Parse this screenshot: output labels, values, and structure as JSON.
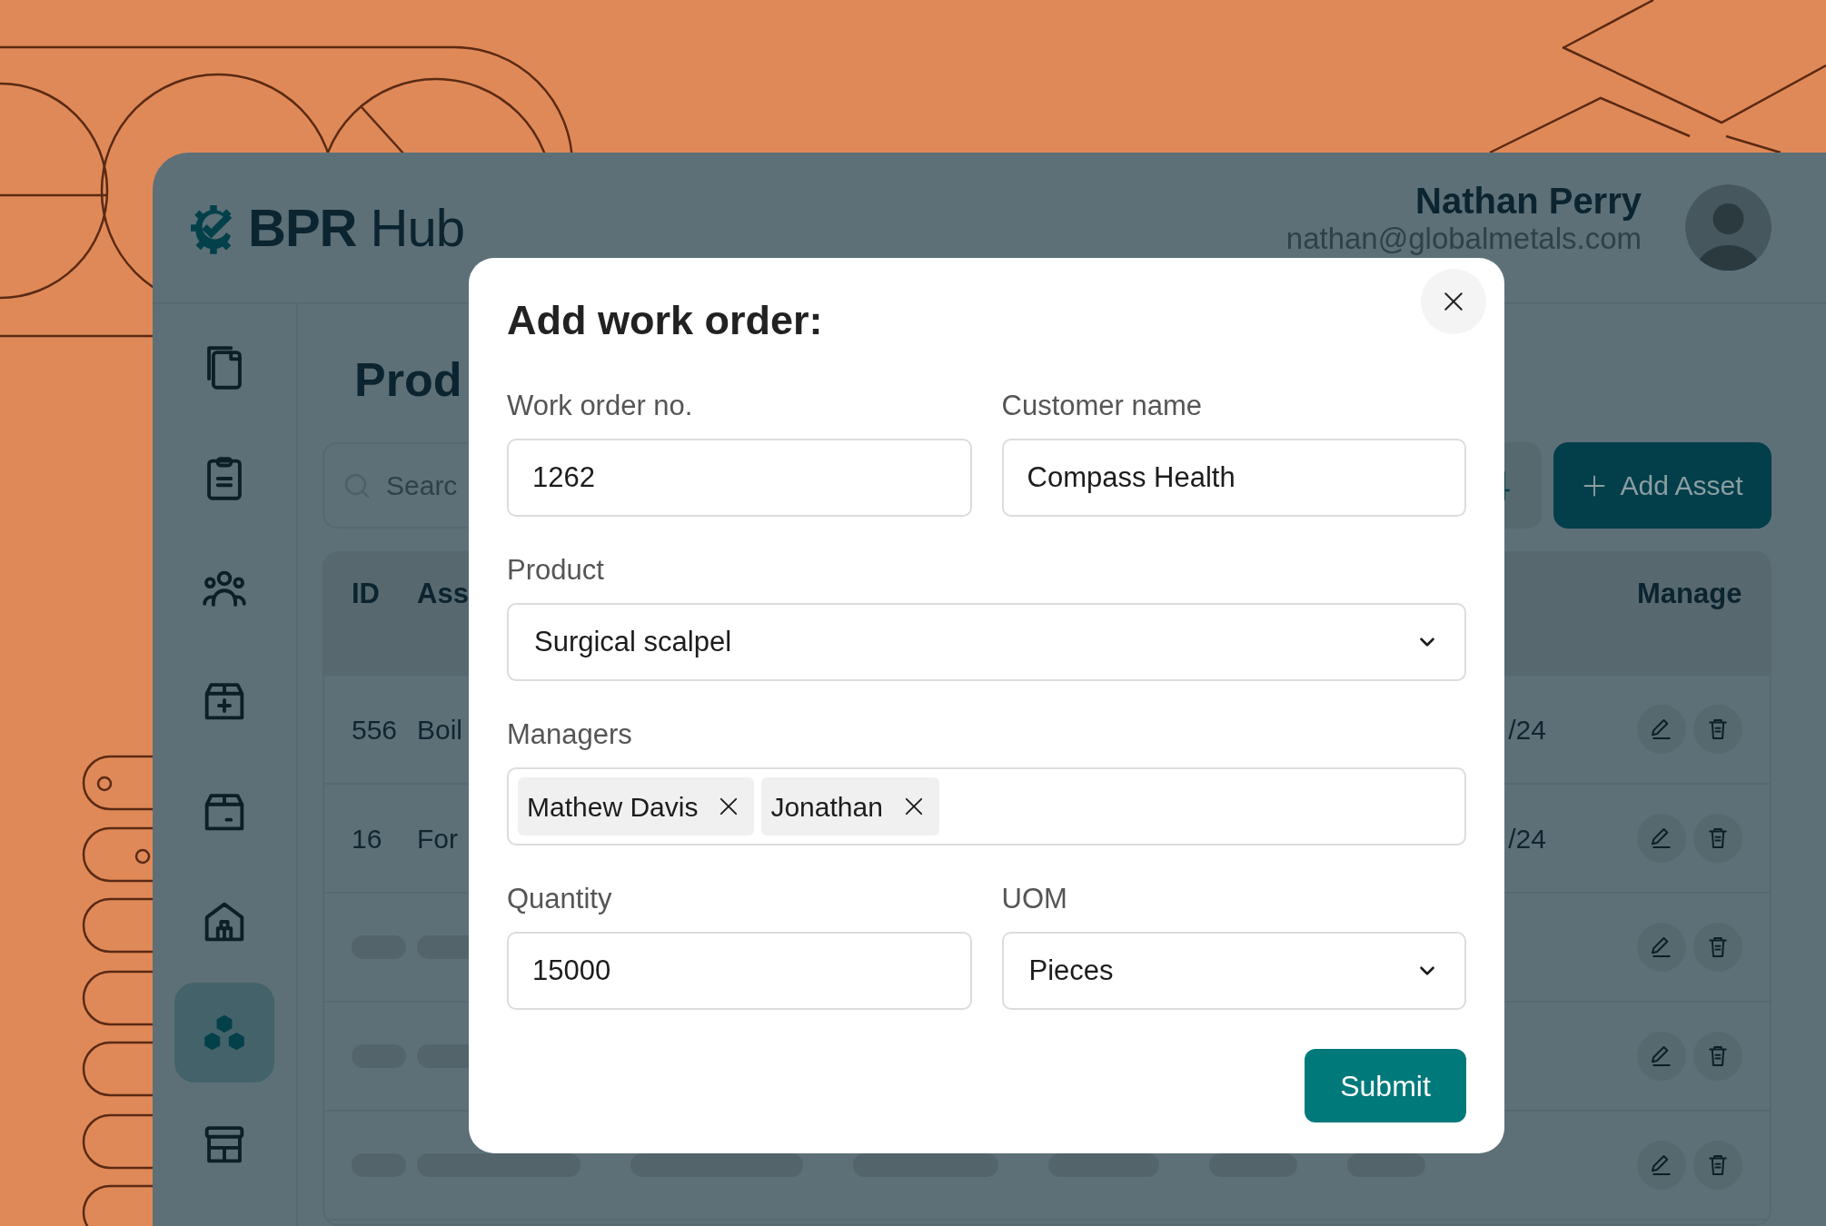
{
  "app": {
    "logo_text": "**BPR** Hub"
  },
  "user": {
    "name": "Nathan Perry",
    "email": "nathan@globalmetals.com"
  },
  "sidebar": {
    "items": [
      {
        "selected": false
      },
      {
        "selected": false
      },
      {
        "selected": false
      },
      {
        "selected": false
      },
      {
        "selected": false
      },
      {
        "selected": false
      },
      {
        "selected": true
      },
      {
        "selected": false
      }
    ]
  },
  "page": {
    "title": "Prod"
  },
  "toolbar": {
    "search": {
      "placeholder": "Searc"
    },
    "add_button": "Add Asset"
  },
  "table": {
    "columns": [
      "ID",
      "Ass",
      "Manage"
    ],
    "rows": [
      {
        "kind": "data",
        "cells": [
          "556",
          "Boil",
          "/24"
        ]
      },
      {
        "kind": "data",
        "cells": [
          "16",
          "For",
          "/24"
        ]
      },
      {
        "kind": "skeleton"
      },
      {
        "kind": "skeleton"
      },
      {
        "kind": "skeleton"
      }
    ]
  },
  "modal": {
    "title": "Add work order:",
    "rows": [
      [
        {
          "kind": "text",
          "label": "Work order no.",
          "value": "1262"
        },
        {
          "kind": "text",
          "label": "Customer name",
          "value": "Compass Health"
        }
      ],
      [
        {
          "kind": "select",
          "label": "Product",
          "value": "Surgical scalpel"
        }
      ],
      [
        {
          "kind": "tags",
          "label": "Managers",
          "tags": [
            "Mathew Davis",
            "Jonathan"
          ]
        }
      ],
      [
        {
          "kind": "text",
          "label": "Quantity",
          "value": "15000"
        },
        {
          "kind": "select",
          "label": "UOM",
          "value": "Pieces"
        }
      ]
    ],
    "submit": "Submit"
  }
}
